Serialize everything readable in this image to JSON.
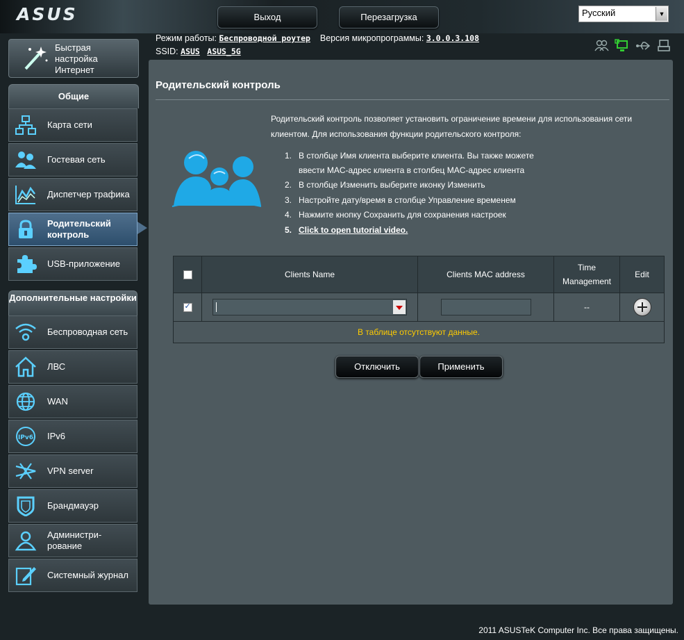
{
  "header": {
    "logo": "ASUS",
    "logout_label": "Выход",
    "reboot_label": "Перезагрузка",
    "language": "Русский"
  },
  "info": {
    "mode_label": "Режим работы:",
    "mode_value": "Беспроводной роутер",
    "firmware_label": "Версия микропрограммы:",
    "firmware_value": "3.0.0.3.108",
    "ssid_label": "SSID:",
    "ssid_1": "ASUS",
    "ssid_2": "ASUS_5G"
  },
  "status_icons": [
    "clients-icon",
    "network-icon",
    "usb-icon",
    "printer-icon"
  ],
  "sidebar": {
    "quick_setup": "Быстрая настройка Интернет",
    "general_header": "Общие",
    "general_items": [
      {
        "label": "Карта сети",
        "icon": "network-map-icon"
      },
      {
        "label": "Гостевая сеть",
        "icon": "guest-network-icon"
      },
      {
        "label": "Диспетчер трафика",
        "icon": "traffic-manager-icon"
      },
      {
        "label": "Родительский контроль",
        "icon": "lock-icon",
        "active": true
      },
      {
        "label": "USB-приложение",
        "icon": "puzzle-icon"
      }
    ],
    "advanced_header": "Дополнительные настройки",
    "advanced_items": [
      {
        "label": "Беспроводная сеть",
        "icon": "wifi-icon"
      },
      {
        "label": "ЛВС",
        "icon": "home-icon"
      },
      {
        "label": "WAN",
        "icon": "globe-icon"
      },
      {
        "label": "IPv6",
        "icon": "ipv6-icon"
      },
      {
        "label": "VPN server",
        "icon": "vpn-icon"
      },
      {
        "label": "Брандмауэр",
        "icon": "shield-icon"
      },
      {
        "label": "Администри-рование",
        "icon": "admin-user-icon"
      },
      {
        "label": "Системный журнал",
        "icon": "log-edit-icon"
      }
    ]
  },
  "main": {
    "title": "Родительский контроль",
    "description": "Родительский контроль позволяет установить ограничение времени для использования сети клиентом. Для использования функции родительского контроля:",
    "steps": [
      {
        "n": "1.",
        "text": "В столбце Имя клиента выберите клиента. Вы также можете ввести MAC-адрес клиента в столбец MAC-адрес клиента"
      },
      {
        "n": "2.",
        "text": "В столбце Изменить выберите иконку Изменить"
      },
      {
        "n": "3.",
        "text": "Настройте дату/время в столбце Управление временем"
      },
      {
        "n": "4.",
        "text": "Нажмите кнопку Сохранить для сохранения настроек"
      }
    ],
    "tutorial": {
      "n": "5.",
      "text": "Click to open tutorial video."
    },
    "table": {
      "headers": [
        "Clients Name",
        "Clients MAC address",
        "Time Management",
        "Edit"
      ],
      "row_time_value": "--",
      "empty_message": "В таблице отсутствуют данные."
    },
    "disable_label": "Отключить",
    "apply_label": "Применить"
  },
  "footer": "2011 ASUSTeK Computer Inc. Все права защищены."
}
